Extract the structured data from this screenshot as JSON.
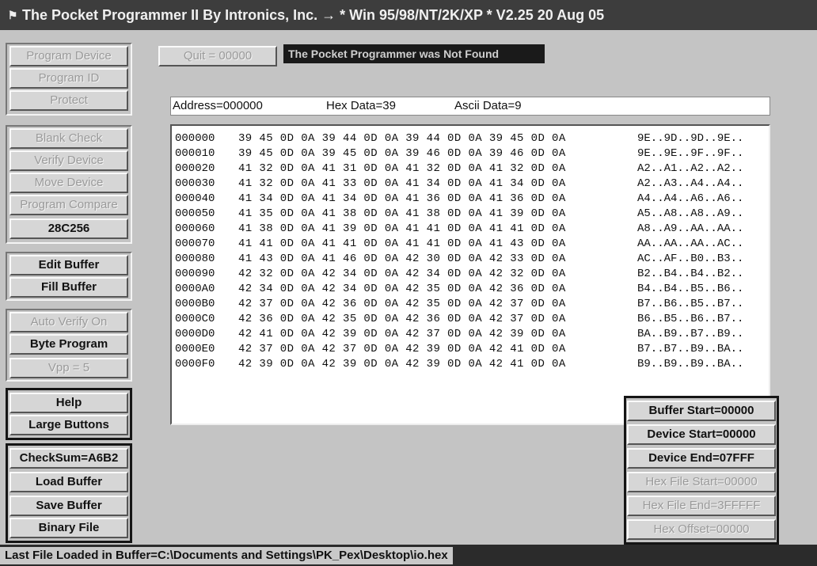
{
  "window": {
    "title": "The Pocket Programmer II By Intronics, Inc.  → * Win 95/98/NT/2K/XP *  V2.25  20 Aug 05"
  },
  "top": {
    "quit_label": "Quit = 00000",
    "status_message": "The Pocket Programmer was Not Found"
  },
  "left_groups": [
    {
      "buttons": [
        {
          "label": "Program Device",
          "enabled": false
        },
        {
          "label": "Program ID",
          "enabled": false
        },
        {
          "label": "Protect",
          "enabled": false
        }
      ]
    },
    {
      "buttons": [
        {
          "label": "Blank Check",
          "enabled": false
        },
        {
          "label": "Verify Device",
          "enabled": false
        },
        {
          "label": "Move Device",
          "enabled": false
        },
        {
          "label": "Program Compare",
          "enabled": false
        },
        {
          "label": "28C256",
          "enabled": true
        }
      ]
    },
    {
      "buttons": [
        {
          "label": "Edit Buffer",
          "enabled": true
        },
        {
          "label": "Fill Buffer",
          "enabled": true
        }
      ]
    },
    {
      "buttons": [
        {
          "label": "Auto Verify On",
          "enabled": false
        },
        {
          "label": "Byte Program",
          "enabled": true
        },
        {
          "label": "Vpp = 5",
          "enabled": false
        }
      ]
    },
    {
      "buttons": [
        {
          "label": "Help",
          "enabled": true
        },
        {
          "label": "Large Buttons",
          "enabled": true
        }
      ]
    },
    {
      "buttons": [
        {
          "label": "CheckSum=A6B2",
          "enabled": true
        },
        {
          "label": "Load Buffer",
          "enabled": true
        },
        {
          "label": "Save Buffer",
          "enabled": true
        },
        {
          "label": "Binary File",
          "enabled": true
        }
      ]
    }
  ],
  "info_bar": {
    "address": "Address=000000",
    "hex_data": "Hex Data=39",
    "ascii_data": "Ascii Data=9"
  },
  "hex_rows": [
    {
      "addr": "000000",
      "bytes": "39 45 0D 0A 39 44 0D 0A 39 44 0D 0A 39 45 0D 0A",
      "ascii": "9E..9D..9D..9E.."
    },
    {
      "addr": "000010",
      "bytes": "39 45 0D 0A 39 45 0D 0A 39 46 0D 0A 39 46 0D 0A",
      "ascii": "9E..9E..9F..9F.."
    },
    {
      "addr": "000020",
      "bytes": "41 32 0D 0A 41 31 0D 0A 41 32 0D 0A 41 32 0D 0A",
      "ascii": "A2..A1..A2..A2.."
    },
    {
      "addr": "000030",
      "bytes": "41 32 0D 0A 41 33 0D 0A 41 34 0D 0A 41 34 0D 0A",
      "ascii": "A2..A3..A4..A4.."
    },
    {
      "addr": "000040",
      "bytes": "41 34 0D 0A 41 34 0D 0A 41 36 0D 0A 41 36 0D 0A",
      "ascii": "A4..A4..A6..A6.."
    },
    {
      "addr": "000050",
      "bytes": "41 35 0D 0A 41 38 0D 0A 41 38 0D 0A 41 39 0D 0A",
      "ascii": "A5..A8..A8..A9.."
    },
    {
      "addr": "000060",
      "bytes": "41 38 0D 0A 41 39 0D 0A 41 41 0D 0A 41 41 0D 0A",
      "ascii": "A8..A9..AA..AA.."
    },
    {
      "addr": "000070",
      "bytes": "41 41 0D 0A 41 41 0D 0A 41 41 0D 0A 41 43 0D 0A",
      "ascii": "AA..AA..AA..AC.."
    },
    {
      "addr": "000080",
      "bytes": "41 43 0D 0A 41 46 0D 0A 42 30 0D 0A 42 33 0D 0A",
      "ascii": "AC..AF..B0..B3.."
    },
    {
      "addr": "000090",
      "bytes": "42 32 0D 0A 42 34 0D 0A 42 34 0D 0A 42 32 0D 0A",
      "ascii": "B2..B4..B4..B2.."
    },
    {
      "addr": "0000A0",
      "bytes": "42 34 0D 0A 42 34 0D 0A 42 35 0D 0A 42 36 0D 0A",
      "ascii": "B4..B4..B5..B6.."
    },
    {
      "addr": "0000B0",
      "bytes": "42 37 0D 0A 42 36 0D 0A 42 35 0D 0A 42 37 0D 0A",
      "ascii": "B7..B6..B5..B7.."
    },
    {
      "addr": "0000C0",
      "bytes": "42 36 0D 0A 42 35 0D 0A 42 36 0D 0A 42 37 0D 0A",
      "ascii": "B6..B5..B6..B7.."
    },
    {
      "addr": "0000D0",
      "bytes": "42 41 0D 0A 42 39 0D 0A 42 37 0D 0A 42 39 0D 0A",
      "ascii": "BA..B9..B7..B9.."
    },
    {
      "addr": "0000E0",
      "bytes": "42 37 0D 0A 42 37 0D 0A 42 39 0D 0A 42 41 0D 0A",
      "ascii": "B7..B7..B9..BA.."
    },
    {
      "addr": "0000F0",
      "bytes": "42 39 0D 0A 42 39 0D 0A 42 39 0D 0A 42 41 0D 0A",
      "ascii": "B9..B9..B9..BA.."
    }
  ],
  "right_buttons": [
    {
      "label": "Buffer Start=00000",
      "enabled": true
    },
    {
      "label": "Device Start=00000",
      "enabled": true
    },
    {
      "label": "Device End=07FFF",
      "enabled": true
    },
    {
      "label": "Hex File Start=00000",
      "enabled": false
    },
    {
      "label": "Hex File End=3FFFFF",
      "enabled": false
    },
    {
      "label": "Hex Offset=00000",
      "enabled": false
    }
  ],
  "status_bar": {
    "text": "Last File Loaded in Buffer=C:\\Documents and Settings\\PK_Pex\\Desktop\\io.hex"
  }
}
